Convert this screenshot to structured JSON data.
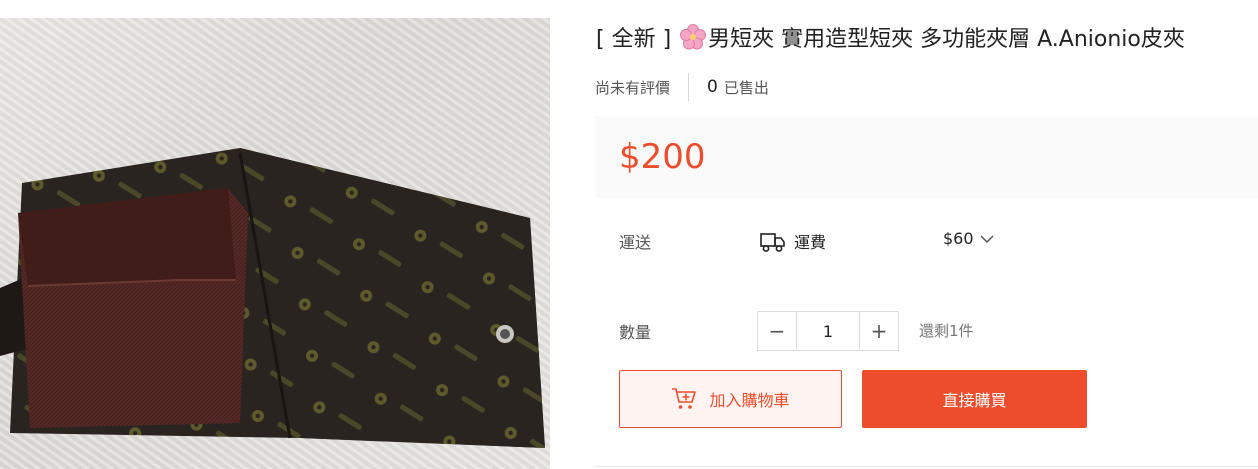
{
  "product": {
    "image_alt": "",
    "title_prefix": "[ 全新 ]",
    "title_text": "男短夾 實用造型短夾 多功能夾層 A.Anionio皮夾",
    "rating_text": "尚未有評價",
    "sold_count": "0",
    "sold_label": "已售出",
    "price": "$200"
  },
  "shipping": {
    "label": "運送",
    "fee_label": "運費",
    "fee_value": "$60",
    "icon": "truck-icon"
  },
  "quantity": {
    "label": "數量",
    "minus": "−",
    "value": "1",
    "plus": "+",
    "stock_text": "還剩1件"
  },
  "actions": {
    "add_to_cart": "加入購物車",
    "buy_now": "直接購買"
  },
  "colors": {
    "accent": "#ee4d2d",
    "cart_bg": "#fff4f2"
  }
}
